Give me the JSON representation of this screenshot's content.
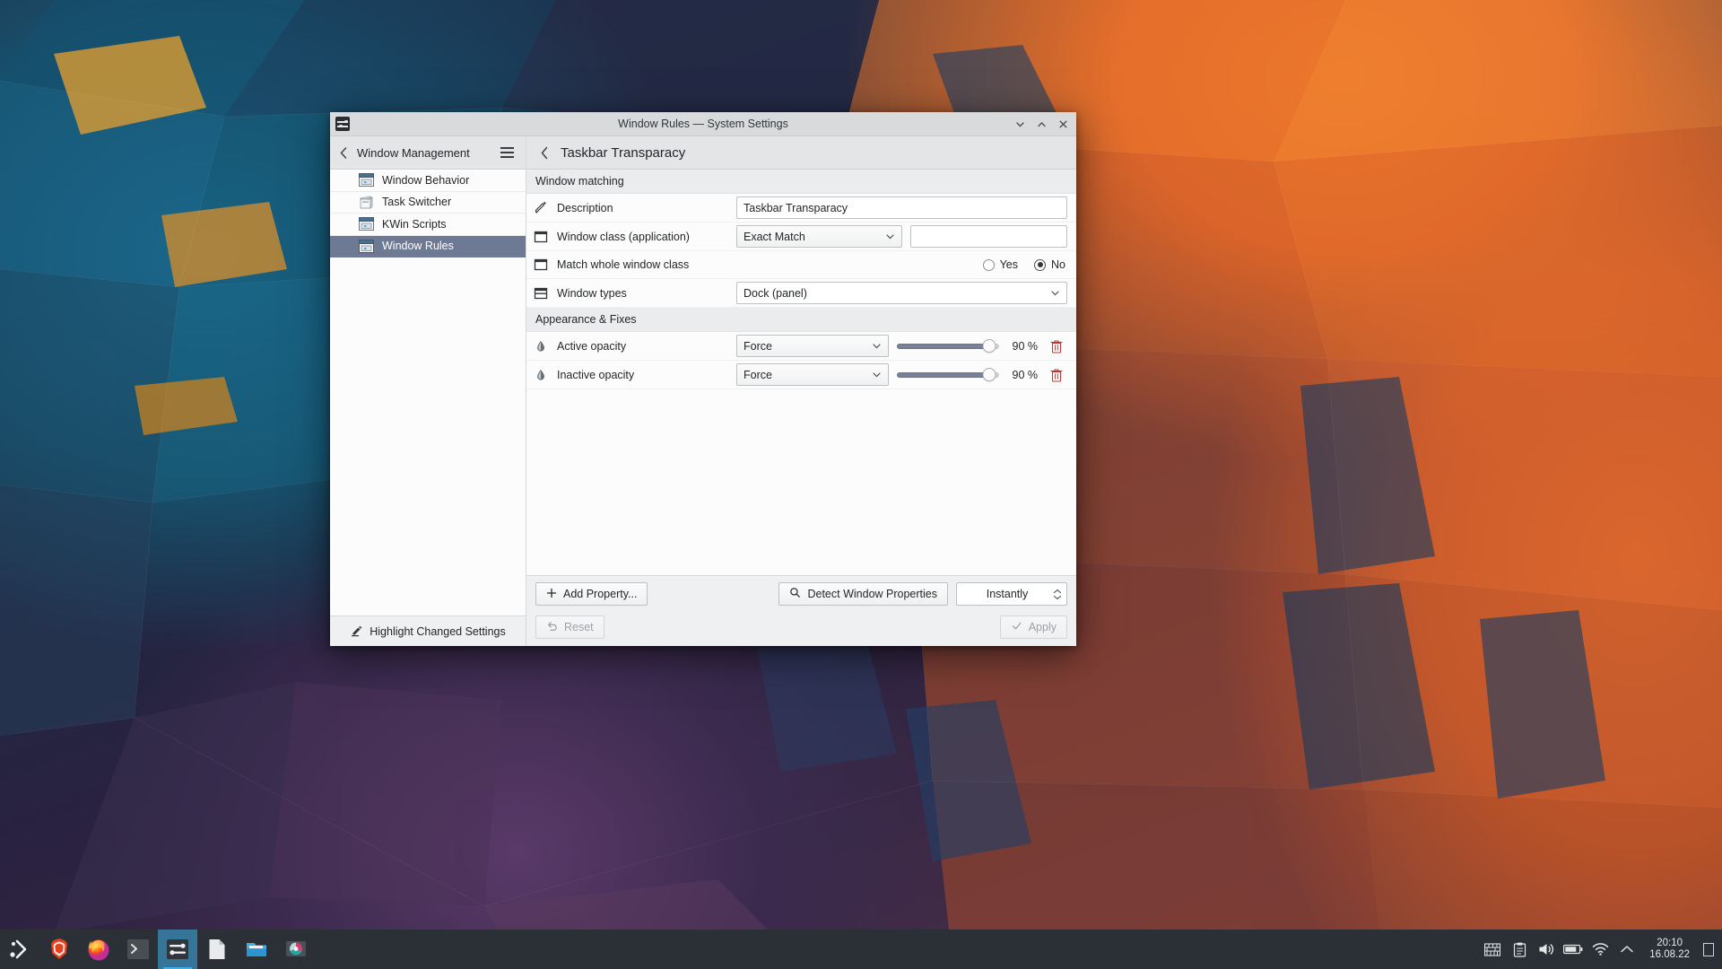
{
  "window": {
    "title": "Window Rules — System Settings",
    "icon": "system-settings-icon",
    "controls": {
      "minimize": "minimize-icon",
      "maximize": "maximize-icon",
      "close": "close-icon"
    }
  },
  "sidebar": {
    "header_title": "Window Management",
    "back_icon": "back-chevron-icon",
    "menu_icon": "hamburger-menu-icon",
    "items": [
      {
        "label": "Window Behavior",
        "icon": "window-behavior-icon",
        "selected": false
      },
      {
        "label": "Task Switcher",
        "icon": "task-switcher-icon",
        "selected": false
      },
      {
        "label": "KWin Scripts",
        "icon": "kwin-scripts-icon",
        "selected": false
      },
      {
        "label": "Window Rules",
        "icon": "window-rules-icon",
        "selected": true
      }
    ],
    "footer": {
      "label": "Highlight Changed Settings",
      "icon": "highlighter-icon"
    }
  },
  "main": {
    "header_title": "Taskbar Transparacy",
    "back_icon": "back-chevron-icon",
    "sections": [
      {
        "title": "Window matching",
        "rows": [
          {
            "label": "Description",
            "icon": "pencil-icon",
            "type": "text",
            "value": "Taskbar Transparacy"
          },
          {
            "label": "Window class (application)",
            "icon": "window-icon",
            "type": "combo-text",
            "combo_value": "Exact Match",
            "text_value": ""
          },
          {
            "label": "Match whole window class",
            "icon": "window-icon",
            "type": "radio",
            "options": [
              {
                "label": "Yes",
                "selected": false
              },
              {
                "label": "No",
                "selected": true
              }
            ]
          },
          {
            "label": "Window types",
            "icon": "window-types-icon",
            "type": "combo-wide",
            "value": "Dock (panel)"
          }
        ]
      },
      {
        "title": "Appearance & Fixes",
        "rows": [
          {
            "label": "Active opacity",
            "icon": "opacity-drop-icon",
            "type": "slider",
            "mode": "Force",
            "percent": "90 %",
            "percent_value": 90,
            "delete_icon": "trash-icon"
          },
          {
            "label": "Inactive opacity",
            "icon": "opacity-drop-icon",
            "type": "slider",
            "mode": "Force",
            "percent": "90 %",
            "percent_value": 90,
            "delete_icon": "trash-icon"
          }
        ]
      }
    ],
    "footer": {
      "add_property": "Add Property...",
      "add_property_icon": "plus-icon",
      "detect": "Detect Window Properties",
      "detect_icon": "search-icon",
      "delay": "Instantly",
      "reset": "Reset",
      "reset_icon": "undo-icon",
      "apply": "Apply",
      "apply_icon": "check-icon"
    }
  },
  "taskbar": {
    "launcher": {
      "name": "kde-launcher-icon"
    },
    "apps": [
      {
        "name": "brave-browser-icon",
        "active": false
      },
      {
        "name": "firefox-icon",
        "active": false
      },
      {
        "name": "terminal-icon",
        "active": false
      },
      {
        "name": "system-settings-icon",
        "active": true
      },
      {
        "name": "text-editor-icon",
        "active": false
      },
      {
        "name": "file-manager-icon",
        "active": false
      },
      {
        "name": "screenshot-tool-icon",
        "active": false
      }
    ],
    "tray": [
      {
        "name": "keyboard-layout-icon"
      },
      {
        "name": "clipboard-icon"
      },
      {
        "name": "volume-icon"
      },
      {
        "name": "battery-icon"
      },
      {
        "name": "wifi-icon"
      },
      {
        "name": "show-hidden-icon"
      }
    ],
    "clock": {
      "time": "20:10",
      "date": "16.08.22"
    },
    "peek": {
      "name": "peek-desktop-icon"
    }
  },
  "colors": {
    "accent": "#3daee9",
    "selection": "#6e7a94",
    "window_bg": "#eff0f1",
    "taskbar_bg": "#2b3036",
    "delete_red": "#bd3a3a"
  }
}
